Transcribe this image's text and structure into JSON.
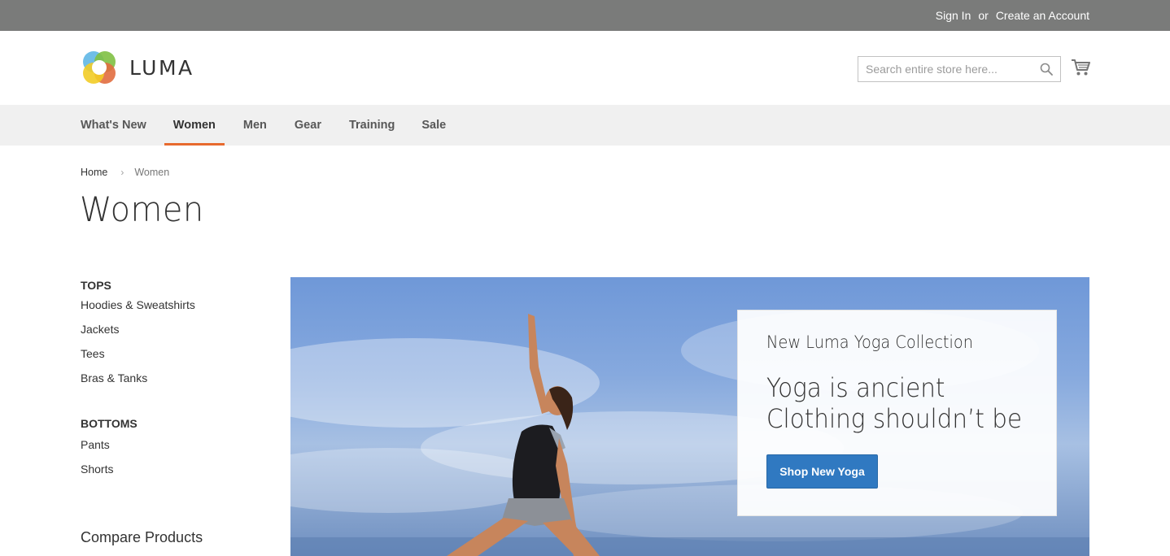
{
  "topbar": {
    "sign_in": "Sign In",
    "or": "or",
    "create_account": "Create an Account"
  },
  "header": {
    "logo_text": "LUMA",
    "search": {
      "placeholder": "Search entire store here...",
      "value": ""
    },
    "icons": {
      "search": "search-icon",
      "cart": "cart-icon"
    }
  },
  "nav": {
    "items": [
      {
        "label": "What's New",
        "active": false
      },
      {
        "label": "Women",
        "active": true
      },
      {
        "label": "Men",
        "active": false
      },
      {
        "label": "Gear",
        "active": false
      },
      {
        "label": "Training",
        "active": false
      },
      {
        "label": "Sale",
        "active": false
      }
    ]
  },
  "breadcrumb": {
    "items": [
      "Home",
      "Women"
    ]
  },
  "page": {
    "title": "Women"
  },
  "sidebar": {
    "groups": [
      {
        "title": "TOPS",
        "items": [
          "Hoodies & Sweatshirts",
          "Jackets",
          "Tees",
          "Bras & Tanks"
        ]
      },
      {
        "title": "BOTTOMS",
        "items": [
          "Pants",
          "Shorts"
        ]
      }
    ],
    "compare_title": "Compare Products"
  },
  "hero": {
    "subtitle": "New Luma Yoga Collection",
    "headline_line1": "Yoga is ancient",
    "headline_line2": "Clothing shouldn’t be",
    "button_label": "Shop New Yoga"
  },
  "colors": {
    "topbar": "#7a7b7a",
    "nav_bg": "#f0f0f0",
    "active_underline": "#e76a2e",
    "button": "#3079c1"
  }
}
